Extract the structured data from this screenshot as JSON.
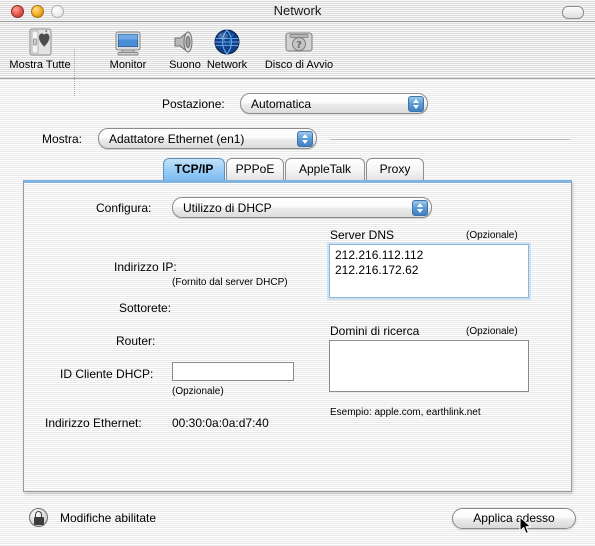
{
  "window": {
    "title": "Network",
    "controls": {
      "close": "close-button",
      "minimize": "minimize-button",
      "zoom": "zoom-button",
      "toolbar_toggle": "toolbar-toggle-button"
    }
  },
  "toolbar": {
    "items": [
      {
        "label": "Mostra Tutte",
        "icon": "show-all-icon"
      },
      {
        "label": "Monitor",
        "icon": "display-icon"
      },
      {
        "label": "Suono",
        "icon": "sound-icon"
      },
      {
        "label": "Network",
        "icon": "network-globe-icon"
      },
      {
        "label": "Disco di Avvio",
        "icon": "startup-disk-icon"
      }
    ]
  },
  "location": {
    "label": "Postazione:",
    "value": "Automatica"
  },
  "show": {
    "label": "Mostra:",
    "value": "Adattatore Ethernet (en1)"
  },
  "tabs": [
    {
      "label": "TCP/IP",
      "active": true
    },
    {
      "label": "PPPoE",
      "active": false
    },
    {
      "label": "AppleTalk",
      "active": false
    },
    {
      "label": "Proxy",
      "active": false
    }
  ],
  "tcpip": {
    "configure": {
      "label": "Configura:",
      "value": "Utilizzo di DHCP"
    },
    "ip_address": {
      "label": "Indirizzo IP:",
      "value": "",
      "hint": "(Fornito dal server DHCP)"
    },
    "subnet": {
      "label": "Sottorete:",
      "value": ""
    },
    "router": {
      "label": "Router:",
      "value": ""
    },
    "dhcp_client_id": {
      "label": "ID Cliente DHCP:",
      "value": "",
      "hint": "(Opzionale)"
    },
    "ethernet_address": {
      "label": "Indirizzo Ethernet:",
      "value": "00:30:0a:0a:d7:40"
    },
    "dns_servers": {
      "title": "Server DNS",
      "optional": "(Opzionale)",
      "lines": [
        "212.216.112.112",
        "212.216.172.62"
      ]
    },
    "search_domains": {
      "title": "Domini di ricerca",
      "optional": "(Opzionale)",
      "lines": [],
      "example": "Esempio: apple.com, earthlink.net"
    }
  },
  "footer": {
    "lock_icon": "lock-closed-icon",
    "lock_label": "Modifiche abilitate",
    "apply_label": "Applica adesso"
  },
  "colors": {
    "accent": "#7dbdf2",
    "panel_top_border": "#7fb4e0",
    "popup_arrow": "#5b9ad8"
  }
}
